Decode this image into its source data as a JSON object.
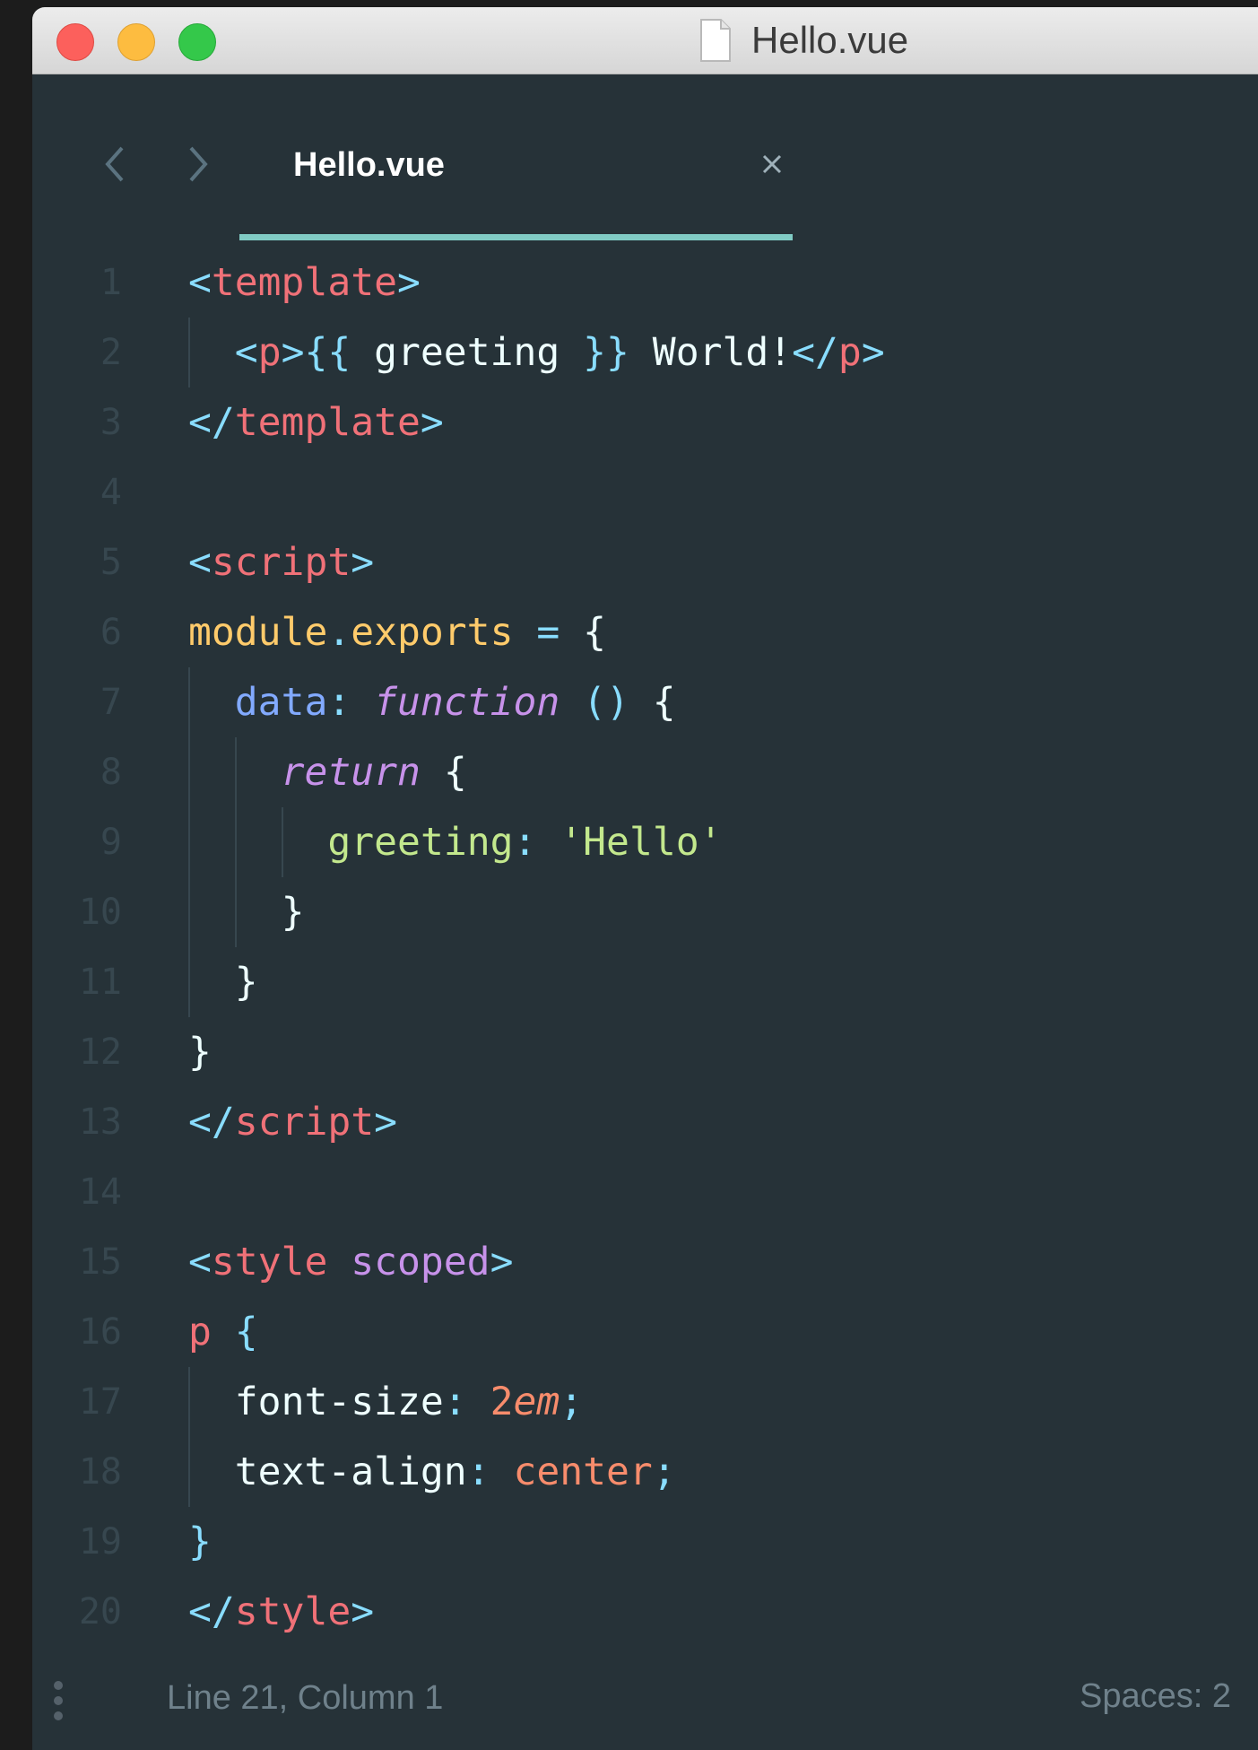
{
  "window": {
    "title": "Hello.vue"
  },
  "tab": {
    "label": "Hello.vue"
  },
  "colors": {
    "background": "#263238",
    "punctuation": "#89ddff",
    "tag": "#f07178",
    "plain": "#eeffff",
    "module": "#ffcb6b",
    "property": "#82aaff",
    "keyword": "#c792ea",
    "string": "#c3e88d",
    "number": "#f78c6c",
    "accent": "#80cbc4"
  },
  "editor": {
    "lines": [
      {
        "num": "1"
      },
      {
        "num": "2"
      },
      {
        "num": "3"
      },
      {
        "num": "4"
      },
      {
        "num": "5"
      },
      {
        "num": "6"
      },
      {
        "num": "7"
      },
      {
        "num": "8"
      },
      {
        "num": "9"
      },
      {
        "num": "10"
      },
      {
        "num": "11"
      },
      {
        "num": "12"
      },
      {
        "num": "13"
      },
      {
        "num": "14"
      },
      {
        "num": "15"
      },
      {
        "num": "16"
      },
      {
        "num": "17"
      },
      {
        "num": "18"
      },
      {
        "num": "19"
      },
      {
        "num": "20"
      }
    ],
    "code": {
      "l1": [
        "<",
        "template",
        ">"
      ],
      "l2": [
        "<",
        "p",
        ">{{ ",
        "greeting",
        " }}",
        " World!",
        "</",
        "p",
        ">"
      ],
      "l3": [
        "</",
        "template",
        ">"
      ],
      "l5": [
        "<",
        "script",
        ">"
      ],
      "l6": [
        "module",
        ".",
        "exports",
        " = ",
        "{"
      ],
      "l7": [
        "data",
        ": ",
        "function",
        " ",
        "()",
        " {"
      ],
      "l8": [
        "return",
        " {"
      ],
      "l9": [
        "greeting",
        ": ",
        "'Hello'"
      ],
      "l10": [
        "}"
      ],
      "l11": [
        "}"
      ],
      "l12": [
        "}"
      ],
      "l13": [
        "</",
        "script",
        ">"
      ],
      "l15": [
        "<",
        "style",
        " ",
        "scoped",
        ">"
      ],
      "l16": [
        "p",
        " ",
        "{"
      ],
      "l17": [
        "font-size",
        ": ",
        "2",
        "em",
        ";"
      ],
      "l18": [
        "text-align",
        ": ",
        "center",
        ";"
      ],
      "l19": [
        "}"
      ],
      "l20": [
        "</",
        "style",
        ">"
      ]
    }
  },
  "status": {
    "position": "Line 21, Column 1",
    "indent": "Spaces: 2"
  }
}
